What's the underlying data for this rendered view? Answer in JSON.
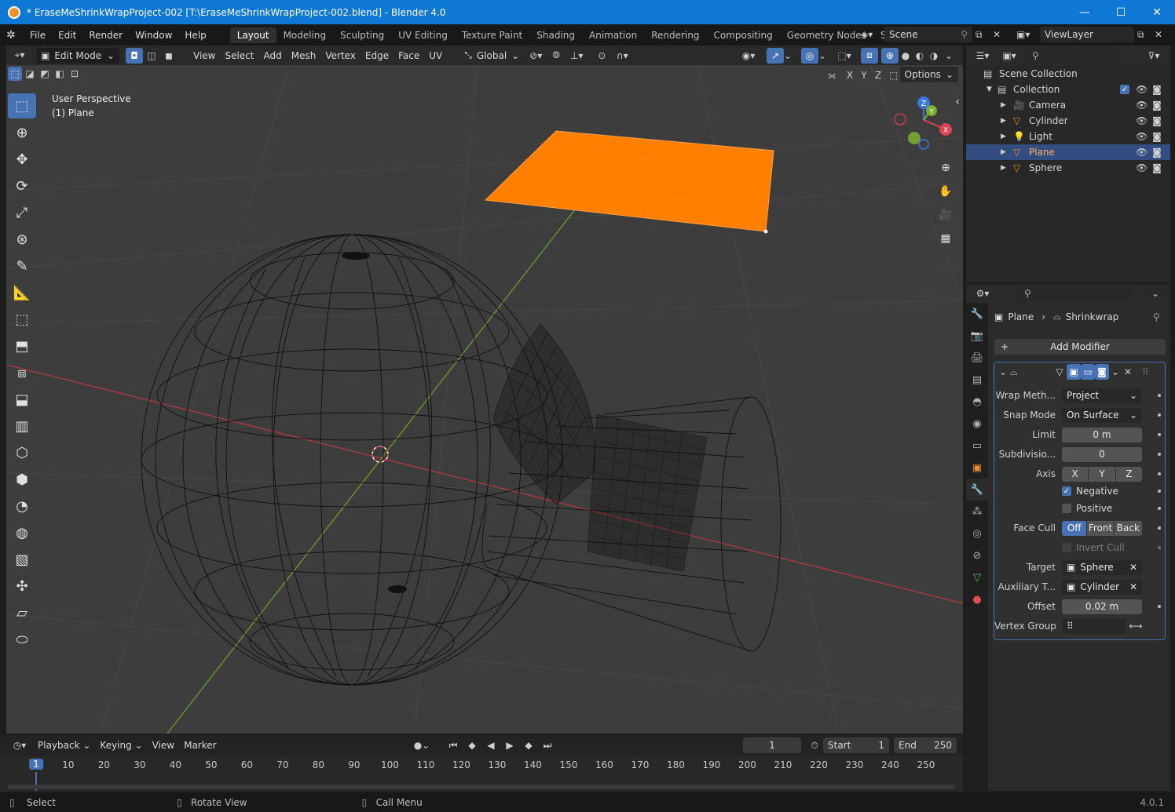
{
  "window": {
    "title": "* EraseMeShrinkWrapProject-002 [T:\\EraseMeShrinkWrapProject-002.blend] - Blender 4.0",
    "minimize": "—",
    "maximize": "☐",
    "close": "✕"
  },
  "menubar": {
    "items": [
      "File",
      "Edit",
      "Render",
      "Window",
      "Help"
    ],
    "workspaces": [
      "Layout",
      "Modeling",
      "Sculpting",
      "UV Editing",
      "Texture Paint",
      "Shading",
      "Animation",
      "Rendering",
      "Compositing",
      "Geometry Nodes",
      "Scripting"
    ],
    "active_workspace": "Layout",
    "scene": "Scene",
    "view_layer": "ViewLayer"
  },
  "viewport_header": {
    "mode": "Edit Mode",
    "menus": [
      "View",
      "Select",
      "Add",
      "Mesh",
      "Vertex",
      "Edge",
      "Face",
      "UV"
    ],
    "orientation": "Global",
    "axes": [
      "X",
      "Y",
      "Z"
    ],
    "options": "Options"
  },
  "viewport": {
    "view_name": "User Perspective",
    "object_info": "(1) Plane",
    "gizmo": {
      "x": "X",
      "y": "Y",
      "z": "Z"
    }
  },
  "outliner": {
    "root": "Scene Collection",
    "collection": "Collection",
    "objects": [
      {
        "name": "Camera",
        "icon": "camera-icon",
        "color": "#e0902f"
      },
      {
        "name": "Cylinder",
        "icon": "mesh-icon",
        "color": "#e0902f"
      },
      {
        "name": "Light",
        "icon": "light-icon",
        "color": "#e0902f"
      },
      {
        "name": "Plane",
        "icon": "mesh-icon",
        "color": "#e0902f",
        "selected": true
      },
      {
        "name": "Sphere",
        "icon": "mesh-icon",
        "color": "#e0902f"
      }
    ]
  },
  "properties": {
    "breadcrumb_object": "Plane",
    "breadcrumb_modifier": "Shrinkwrap",
    "add_modifier": "Add Modifier",
    "fields": {
      "wrap_method_label": "Wrap Meth...",
      "wrap_method": "Project",
      "snap_mode_label": "Snap Mode",
      "snap_mode": "On Surface",
      "limit_label": "Limit",
      "limit": "0 m",
      "subdivision_label": "Subdivisio...",
      "subdivision": "0",
      "axis_label": "Axis",
      "axis_x": "X",
      "axis_y": "Y",
      "axis_z": "Z",
      "negative": "Negative",
      "negative_checked": true,
      "positive": "Positive",
      "positive_checked": false,
      "face_cull_label": "Face Cull",
      "face_cull_off": "Off",
      "face_cull_front": "Front",
      "face_cull_back": "Back",
      "invert_cull": "Invert Cull",
      "target_label": "Target",
      "target": "Sphere",
      "auxiliary_label": "Auxiliary T...",
      "auxiliary": "Cylinder",
      "offset_label": "Offset",
      "offset": "0.02 m",
      "vertex_group_label": "Vertex Group"
    }
  },
  "timeline": {
    "menus": [
      "Playback",
      "Keying",
      "View",
      "Marker"
    ],
    "current_frame": "1",
    "start_label": "Start",
    "start": "1",
    "end_label": "End",
    "end": "250",
    "ticks": [
      "10",
      "20",
      "30",
      "40",
      "50",
      "60",
      "70",
      "80",
      "90",
      "100",
      "110",
      "120",
      "130",
      "140",
      "150",
      "160",
      "170",
      "180",
      "190",
      "200",
      "210",
      "220",
      "230",
      "240",
      "250"
    ],
    "cursor": "1"
  },
  "statusbar": {
    "select": "Select",
    "rotate": "Rotate View",
    "call_menu": "Call Menu",
    "version": "4.0.1"
  },
  "colors": {
    "accent": "#4772b3",
    "plane": "#ff8000",
    "x_axis": "#c0394a",
    "y_axis": "#6e9a2d",
    "titlebar": "#0e78d4"
  }
}
